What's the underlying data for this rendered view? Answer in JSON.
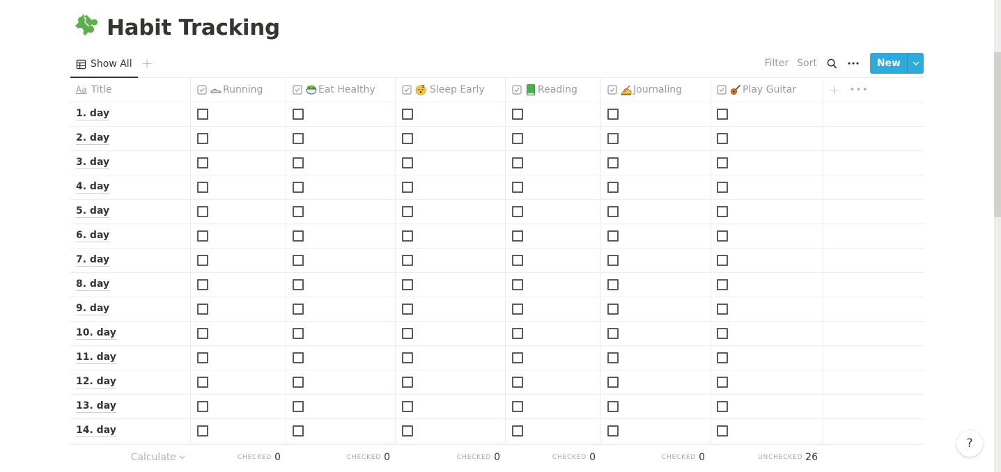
{
  "page": {
    "title": "Habit Tracking",
    "icon": "puzzle-piece-icon"
  },
  "view_bar": {
    "active_view": "Show All",
    "add_view": "+"
  },
  "toolbar": {
    "filter": "Filter",
    "sort": "Sort",
    "search_icon": "search-icon",
    "more_icon": "more-icon",
    "new_label": "New",
    "new_color": "#2eaadc"
  },
  "table": {
    "title_column": {
      "icon": "Aa",
      "label": "Title"
    },
    "columns": [
      {
        "label": "Running",
        "emoji": "running-shoe-icon"
      },
      {
        "label": "Eat Healthy",
        "emoji": "salad-icon"
      },
      {
        "label": "Sleep Early",
        "emoji": "sleeping-face-icon"
      },
      {
        "label": "Reading",
        "emoji": "green-book-icon"
      },
      {
        "label": "Journaling",
        "emoji": "writing-hand-icon"
      },
      {
        "label": "Play Guitar",
        "emoji": "guitar-icon"
      }
    ],
    "add_column": "+",
    "more": "•••",
    "rows": [
      {
        "title": "1. day",
        "checks": [
          false,
          false,
          false,
          false,
          false,
          false
        ]
      },
      {
        "title": "2. day",
        "checks": [
          false,
          false,
          false,
          false,
          false,
          false
        ]
      },
      {
        "title": "3. day",
        "checks": [
          false,
          false,
          false,
          false,
          false,
          false
        ]
      },
      {
        "title": "4. day",
        "checks": [
          false,
          false,
          false,
          false,
          false,
          false
        ]
      },
      {
        "title": "5. day",
        "checks": [
          false,
          false,
          false,
          false,
          false,
          false
        ]
      },
      {
        "title": "6. day",
        "checks": [
          false,
          false,
          false,
          false,
          false,
          false
        ]
      },
      {
        "title": "7. day",
        "checks": [
          false,
          false,
          false,
          false,
          false,
          false
        ]
      },
      {
        "title": "8. day",
        "checks": [
          false,
          false,
          false,
          false,
          false,
          false
        ]
      },
      {
        "title": "9. day",
        "checks": [
          false,
          false,
          false,
          false,
          false,
          false
        ]
      },
      {
        "title": "10. day",
        "checks": [
          false,
          false,
          false,
          false,
          false,
          false
        ]
      },
      {
        "title": "11. day",
        "checks": [
          false,
          false,
          false,
          false,
          false,
          false
        ]
      },
      {
        "title": "12. day",
        "checks": [
          false,
          false,
          false,
          false,
          false,
          false
        ]
      },
      {
        "title": "13. day",
        "checks": [
          false,
          false,
          false,
          false,
          false,
          false
        ]
      },
      {
        "title": "14. day",
        "checks": [
          false,
          false,
          false,
          false,
          false,
          false
        ]
      }
    ]
  },
  "footer": {
    "calculate_label": "Calculate",
    "aggregates": [
      {
        "label": "Checked",
        "value": "0"
      },
      {
        "label": "Checked",
        "value": "0"
      },
      {
        "label": "Checked",
        "value": "0"
      },
      {
        "label": "Checked",
        "value": "0"
      },
      {
        "label": "Checked",
        "value": "0"
      },
      {
        "label": "Unchecked",
        "value": "26"
      }
    ]
  },
  "help_button": "?",
  "scroll": {
    "position_fraction": 0.11,
    "visible_fraction": 0.35
  }
}
